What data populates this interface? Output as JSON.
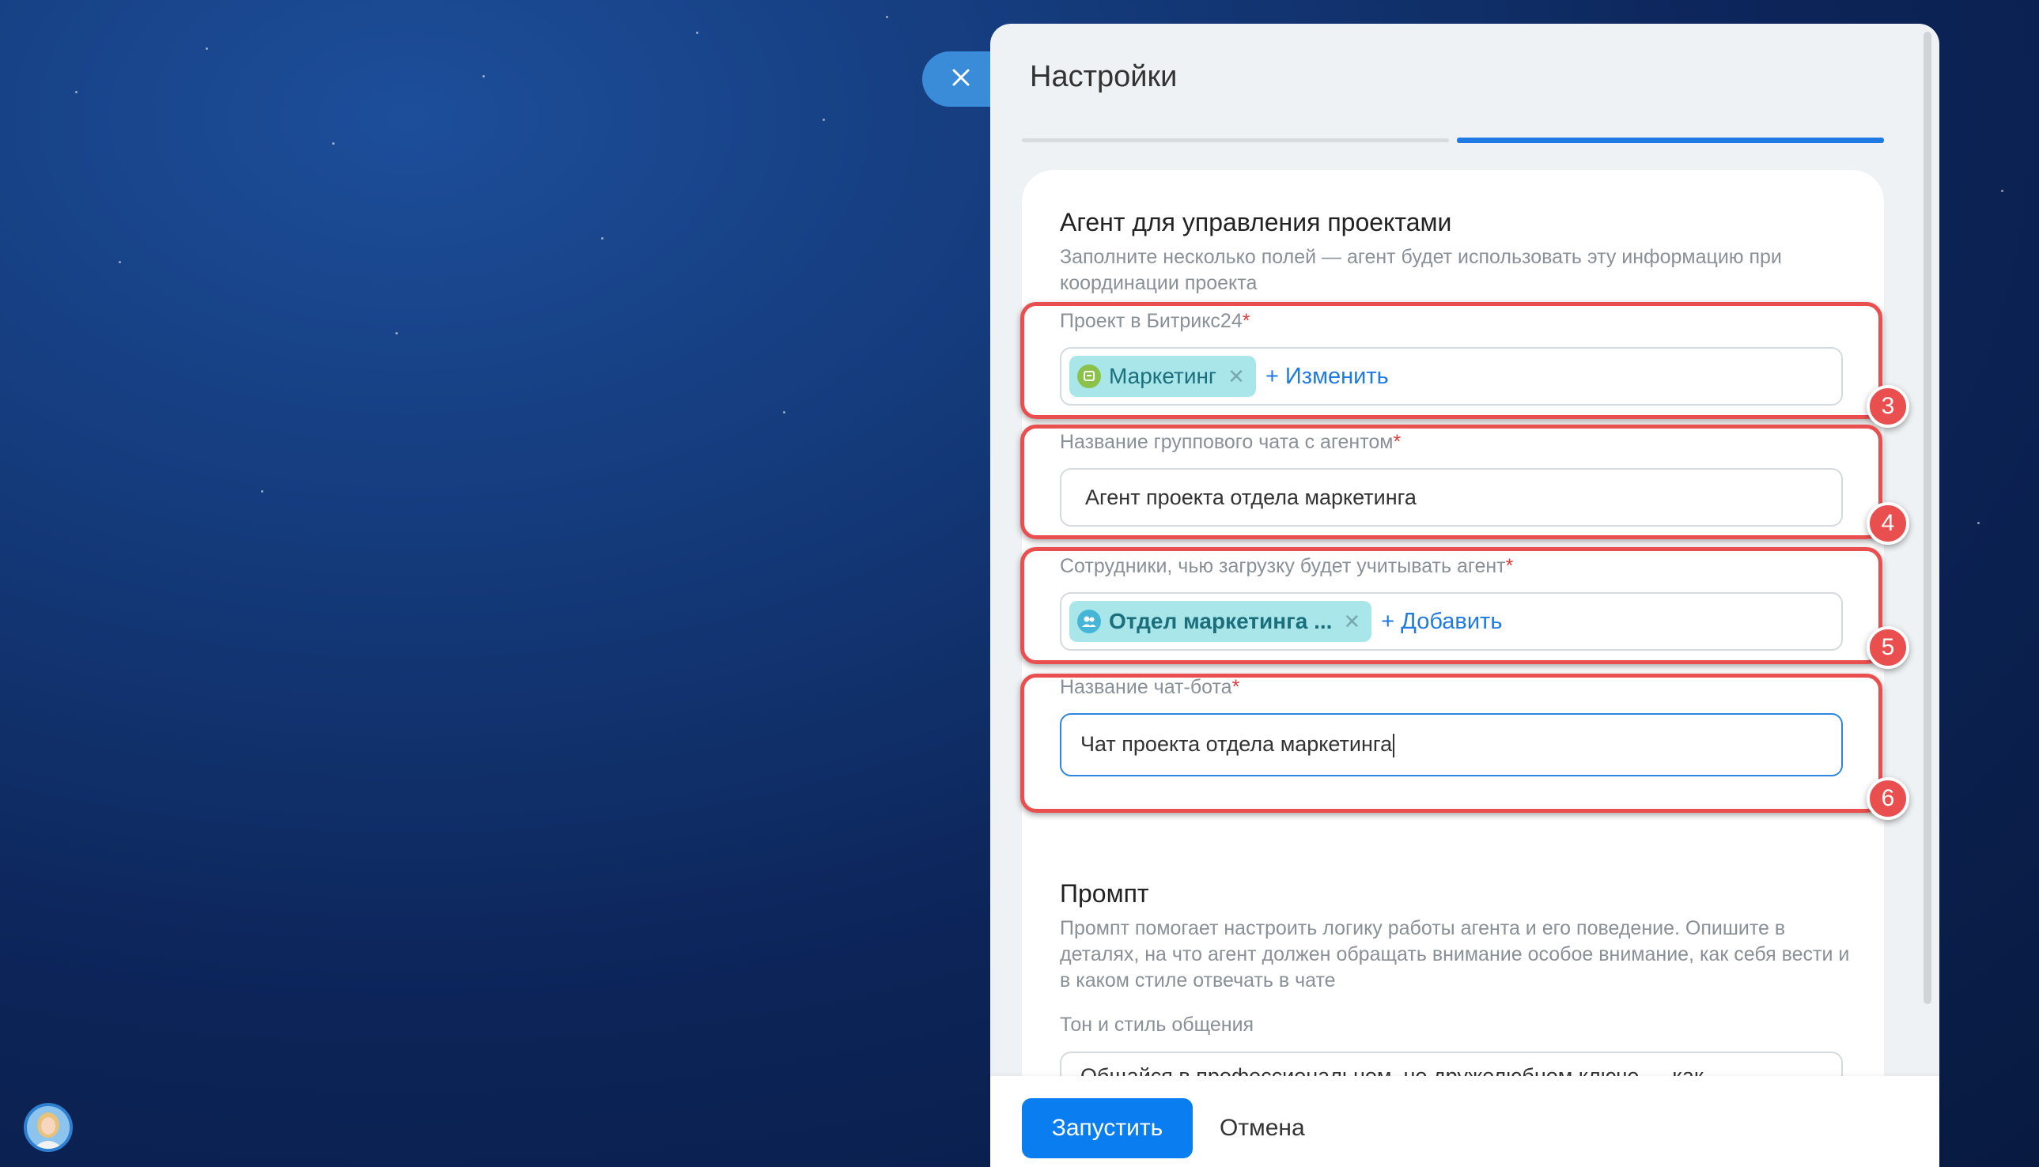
{
  "panel": {
    "title": "Настройки"
  },
  "card_agent": {
    "title": "Агент для управления проектами",
    "description": "Заполните несколько полей — агент будет использовать эту информацию при координации проекта",
    "project_field": {
      "label": "Проект в Битрикс24",
      "required_mark": "*",
      "chip_label": "Маркетинг",
      "action_label": "+ Изменить"
    },
    "chat_name_field": {
      "label": "Название группового чата с агентом",
      "required_mark": "*",
      "value": "Агент проекта отдела маркетинга"
    },
    "employees_field": {
      "label": "Сотрудники, чью загрузку будет учитывать агент",
      "required_mark": "*",
      "chip_label": "Отдел маркетинга ...",
      "action_label": "+ Добавить"
    },
    "bot_name_field": {
      "label": "Название чат-бота",
      "required_mark": "*",
      "value": "Чат проекта отдела маркетинга"
    }
  },
  "card_prompt": {
    "title": "Промпт",
    "description": "Промпт помогает настроить логику работы агента и его поведение. Опишите в деталях, на что агент должен обращать внимание особое внимание, как себя вести и в каком стиле отвечать в чате",
    "tone_label": "Тон и стиль общения",
    "tone_value": "Общайся в профессиональном, но дружелюбном ключе — как"
  },
  "callouts": [
    "3",
    "4",
    "5",
    "6"
  ],
  "footer": {
    "run_label": "Запустить",
    "cancel_label": "Отмена"
  },
  "colors": {
    "accent": "#0a7df0",
    "highlight": "#ea4f4f",
    "chip": "#a9e6ea",
    "progress_active": "#1f7be3"
  },
  "icons": {
    "close": "close-icon",
    "project": "project-icon",
    "department": "group-icon",
    "avatar": "user-avatar"
  }
}
